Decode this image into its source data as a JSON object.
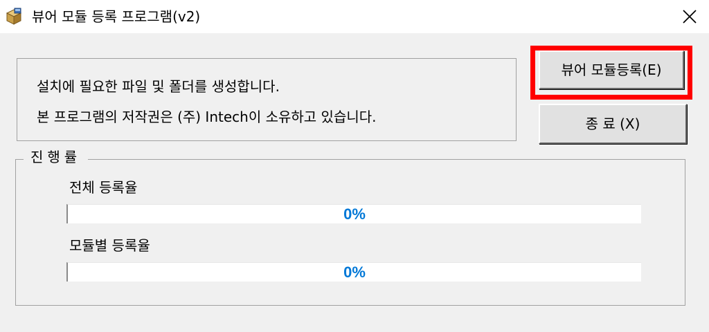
{
  "window": {
    "title": "뷰어 모듈 등록 프로그램(v2)",
    "app_icon": "package-icon",
    "close_icon": "close-icon"
  },
  "info": {
    "line1": "설치에 필요한 파일 및 폴더를 생성합니다.",
    "line2": "본 프로그램의 저작권은 (주) Intech이 소유하고 있습니다."
  },
  "buttons": {
    "register_label": "뷰어 모듈등록(E)",
    "exit_label": "종  료 (X)"
  },
  "highlight_color": "#ff0000",
  "progress_group": {
    "label": "진행률",
    "overall": {
      "label": "전체 등록율",
      "value_text": "0%",
      "value": 0
    },
    "module": {
      "label": "모듈별 등록율",
      "value_text": "0%",
      "value": 0
    },
    "text_color": "#0078d7"
  }
}
